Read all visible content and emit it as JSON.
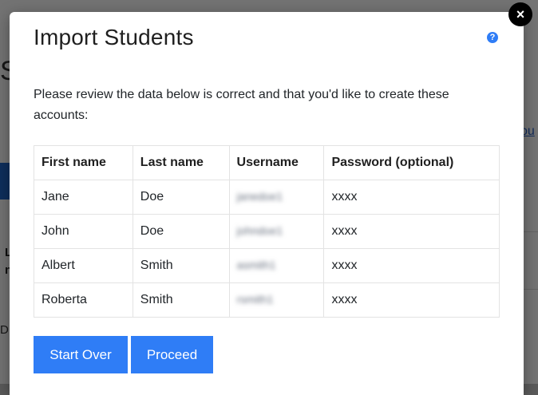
{
  "background": {
    "heading_fragment": "S",
    "link_fragment": "ou",
    "bold_fragment_1": "L",
    "bold_fragment_2": "n",
    "text_fragment": "D"
  },
  "modal": {
    "title": "Import Students",
    "help_icon": "?",
    "close_icon": "×",
    "intro": "Please review the data below is correct and that you'd like to create these accounts:",
    "table": {
      "headers": [
        "First name",
        "Last name",
        "Username",
        "Password (optional)"
      ],
      "rows": [
        [
          "Jane",
          "Doe",
          "janedoe1",
          "xxxx"
        ],
        [
          "John",
          "Doe",
          "johndoe1",
          "xxxx"
        ],
        [
          "Albert",
          "Smith",
          "asmith1",
          "xxxx"
        ],
        [
          "Roberta",
          "Smith",
          "rsmith1",
          "xxxx"
        ]
      ]
    },
    "buttons": {
      "start_over": "Start Over",
      "proceed": "Proceed"
    }
  },
  "colors": {
    "accent": "#2f7df6",
    "backdrop": "rgba(0,0,0,0.55)"
  }
}
